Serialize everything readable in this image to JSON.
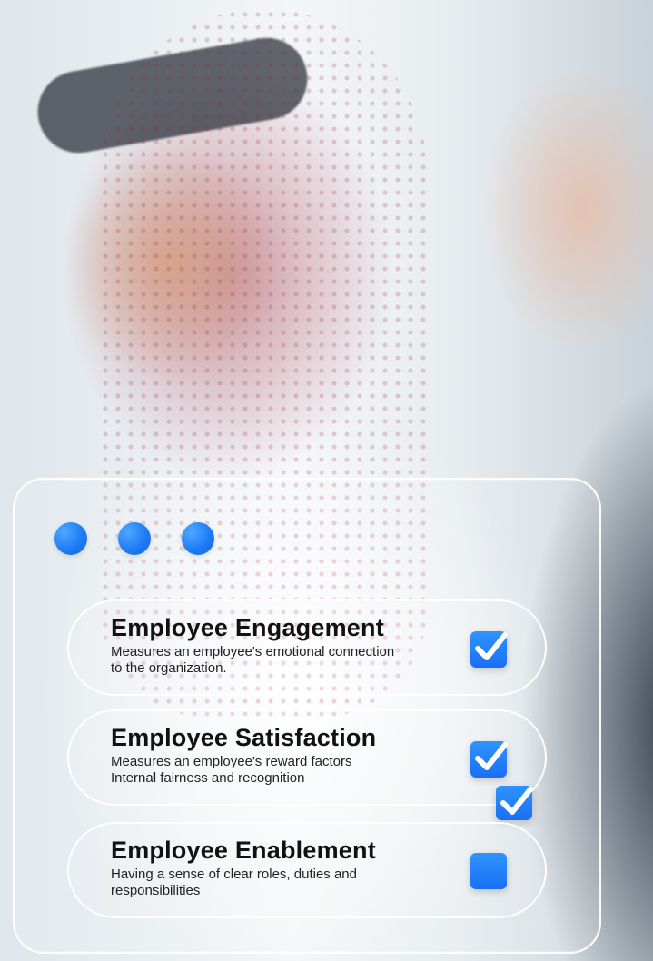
{
  "cards": [
    {
      "title": "Employee Engagement",
      "description": "Measures an employee's emotional connection\nto the organization.",
      "checked": true
    },
    {
      "title": "Employee Satisfaction",
      "description": "Measures an employee's reward factors\nInternal fairness and recognition",
      "checked": true
    },
    {
      "title": "Employee Enablement",
      "description": "Having a sense of clear roles, duties and\nresponsibilities",
      "checked": false
    }
  ],
  "colors": {
    "accent": "#1f7cf6",
    "accent_light": "#4fa8ff"
  },
  "icons": {
    "dot": "blue-dot-icon",
    "checkbox": "checkbox-icon",
    "checkmark": "check-icon"
  }
}
